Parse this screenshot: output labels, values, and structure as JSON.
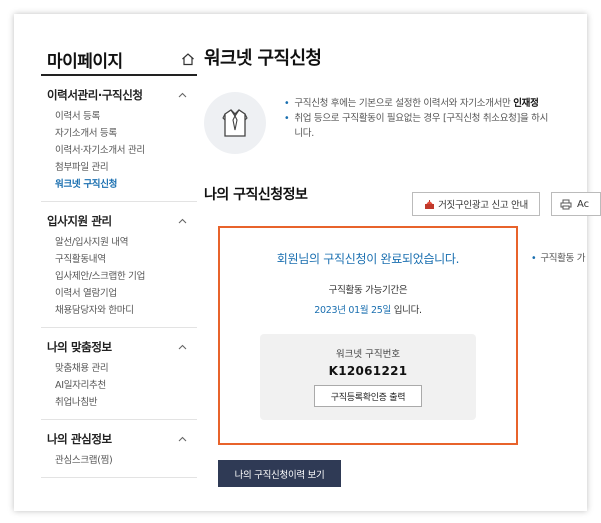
{
  "sidebar": {
    "title": "마이페이지",
    "groups": [
      {
        "title": "이력서관리·구직신청",
        "items": [
          "이력서 등록",
          "자기소개서 등록",
          "이력서·자기소개서 관리",
          "첨부파일 관리",
          "워크넷 구직신청"
        ]
      },
      {
        "title": "입사지원 관리",
        "items": [
          "알선/입사지원 내역",
          "구직활동내역",
          "입사제안/스크랩한 기업",
          "이력서 열람기업",
          "채용담당자와 한마디"
        ]
      },
      {
        "title": "나의 맞춤정보",
        "items": [
          "맞춤채용 관리",
          "AI일자리추천",
          "취업나침반"
        ]
      },
      {
        "title": "나의 관심정보",
        "items": [
          "관심스크랩(찜)"
        ]
      }
    ],
    "active_item": "워크넷 구직신청"
  },
  "main": {
    "title": "워크넷 구직신청",
    "notice": {
      "line1_prefix": "구직신청 후에는 기본으로 설정한 이력서와 자기소개서만 ",
      "line1_bold": "인재정",
      "line2": "취업 등으로 구직활동이 필요없는 경우 [구직신청 취소요청]을 하시",
      "line3": "니다."
    },
    "section_title": "나의 구직신청정보",
    "report_button": "거짓구인광고 신고 안내",
    "print_button": "Ac",
    "result": {
      "headline": "회원님의 구직신청이 완료되었습니다.",
      "period_label": "구직활동 가능기간은",
      "period_date": "2023년 01월 25일",
      "period_suffix": " 입니다.",
      "id_label": "워크넷 구직번호",
      "id_value": "K12061221",
      "cert_button": "구직등록확인증 출력"
    },
    "side_note": "구직활동 가",
    "history_button": "나의 구직신청이력 보기"
  },
  "colors": {
    "accent": "#1a6fb0",
    "highlight_border": "#e8632b",
    "dark_button": "#2f3a55"
  },
  "icons": [
    "home-icon",
    "chevron-up-icon",
    "shirt-tie-icon",
    "report-icon",
    "printer-icon"
  ]
}
